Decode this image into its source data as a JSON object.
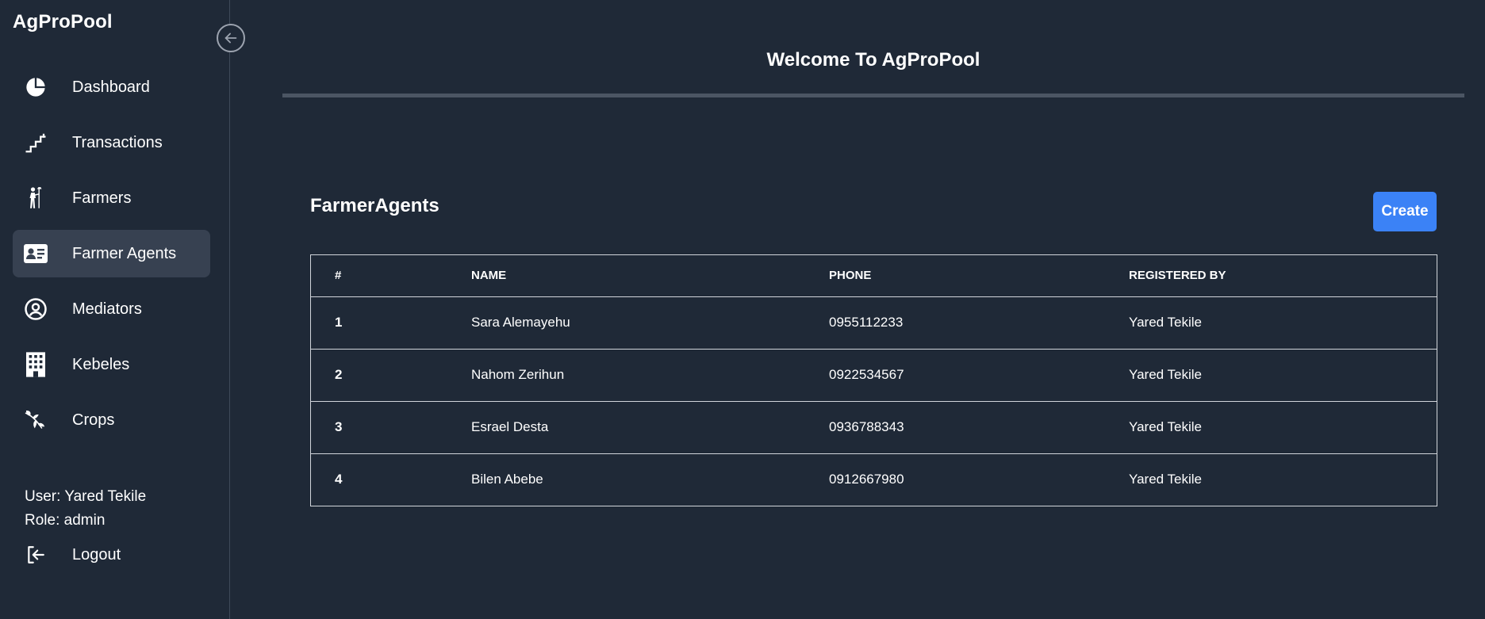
{
  "app": {
    "brand": "AgProPool"
  },
  "sidebar": {
    "collapse_icon": "arrow-left-circle-icon",
    "items": [
      {
        "label": "Dashboard",
        "icon": "pie-chart-icon",
        "active": false
      },
      {
        "label": "Transactions",
        "icon": "stairs-icon",
        "active": false
      },
      {
        "label": "Farmers",
        "icon": "farmer-icon",
        "active": false
      },
      {
        "label": "Farmer Agents",
        "icon": "id-card-icon",
        "active": true
      },
      {
        "label": "Mediators",
        "icon": "user-circle-icon",
        "active": false
      },
      {
        "label": "Kebeles",
        "icon": "building-icon",
        "active": false
      },
      {
        "label": "Crops",
        "icon": "plant-icon",
        "active": false
      }
    ],
    "user_line": "User: Yared Tekile",
    "role_line": "Role: admin",
    "logout_label": "Logout"
  },
  "main": {
    "welcome": "Welcome To AgProPool",
    "section_title": "FarmerAgents",
    "create_label": "Create",
    "table": {
      "headers": [
        "#",
        "NAME",
        "PHONE",
        "REGISTERED BY"
      ],
      "rows": [
        [
          "1",
          "Sara Alemayehu",
          "0955112233",
          "Yared Tekile"
        ],
        [
          "2",
          "Nahom Zerihun",
          "0922534567",
          "Yared Tekile"
        ],
        [
          "3",
          "Esrael Desta",
          "0936788343",
          "Yared Tekile"
        ],
        [
          "4",
          "Bilen Abebe",
          "0912667980",
          "Yared Tekile"
        ]
      ]
    }
  },
  "colors": {
    "background": "#1f2937",
    "active_item": "#374151",
    "accent": "#3b82f6",
    "divider": "#4b5563"
  }
}
